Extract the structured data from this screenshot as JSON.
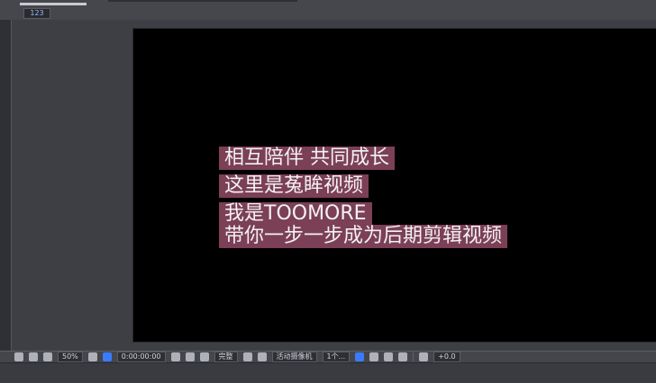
{
  "top": {
    "small_field_value": "123"
  },
  "viewer": {
    "subtitles": [
      "相互陪伴 共同成长",
      "这里是菟眸视频",
      "我是TOOMORE",
      "带你一步一步成为后期剪辑视频"
    ]
  },
  "toolbar": {
    "zoom": "50%",
    "timecode": "0:00:00:00",
    "res": "完整",
    "camera": "活动摄像机",
    "views": "1个...",
    "exposure": "+0.0"
  },
  "colors": {
    "subtitle_bg": "#7b3f56",
    "subtitle_text": "#f2f2f2",
    "accent_blue": "#3a7bff"
  }
}
